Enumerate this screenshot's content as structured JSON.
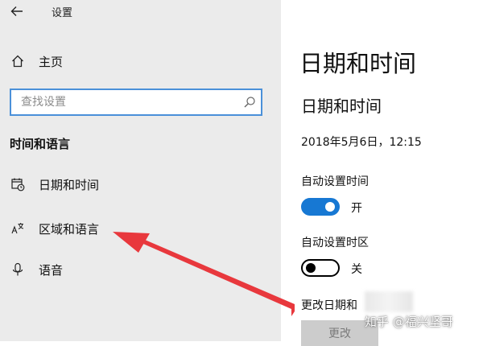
{
  "window": {
    "title": "设置"
  },
  "sidebar": {
    "home_label": "主页",
    "search": {
      "placeholder": "查找设置",
      "value": ""
    },
    "section_title": "时间和语言",
    "items": [
      {
        "label": "日期和时间",
        "icon": "calendar-clock-icon"
      },
      {
        "label": "区域和语言",
        "icon": "language-icon"
      },
      {
        "label": "语音",
        "icon": "microphone-icon"
      }
    ]
  },
  "main": {
    "page_title": "日期和时间",
    "section_title": "日期和时间",
    "current_datetime": "2018年5月6日，12:15",
    "auto_time": {
      "label": "自动设置时间",
      "state_label": "开",
      "on": true
    },
    "auto_timezone": {
      "label": "自动设置时区",
      "state_label": "关",
      "on": false
    },
    "change_datetime": {
      "label": "更改日期和",
      "button_label": "更改"
    }
  },
  "annotation": {
    "arrow_color": "#e8383d",
    "watermark": "知乎 @福兴坚哥"
  },
  "colors": {
    "sidebar_bg": "#ebebeb",
    "accent": "#1778d3",
    "search_border": "#4a90d9"
  }
}
